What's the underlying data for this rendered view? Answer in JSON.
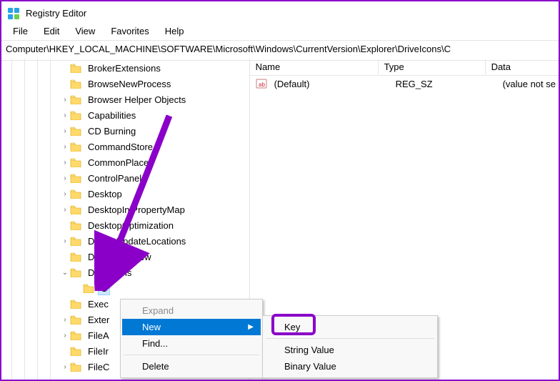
{
  "title": "Registry Editor",
  "menubar": [
    "File",
    "Edit",
    "View",
    "Favorites",
    "Help"
  ],
  "path": "Computer\\HKEY_LOCAL_MACHINE\\SOFTWARE\\Microsoft\\Windows\\CurrentVersion\\Explorer\\DriveIcons\\C",
  "tree": {
    "items": [
      {
        "label": "BrokerExtensions",
        "level": 5,
        "children": false
      },
      {
        "label": "BrowseNewProcess",
        "level": 5,
        "children": false
      },
      {
        "label": "Browser Helper Objects",
        "level": 5,
        "children": true
      },
      {
        "label": "Capabilities",
        "level": 5,
        "children": true
      },
      {
        "label": "CD Burning",
        "level": 5,
        "children": true
      },
      {
        "label": "CommandStore",
        "level": 5,
        "children": true
      },
      {
        "label": "CommonPlaces",
        "level": 5,
        "children": true
      },
      {
        "label": "ControlPanel",
        "level": 5,
        "children": true
      },
      {
        "label": "Desktop",
        "level": 5,
        "children": true
      },
      {
        "label": "DesktopIniPropertyMap",
        "level": 5,
        "children": true
      },
      {
        "label": "DesktopOptimization",
        "level": 5,
        "children": false
      },
      {
        "label": "DeviceUpdateLocations",
        "level": 5,
        "children": true
      },
      {
        "label": "DocObjectView",
        "level": 5,
        "children": false
      },
      {
        "label": "DriveIcons",
        "level": 5,
        "children": true,
        "expanded": true
      },
      {
        "label": "C",
        "level": 6,
        "children": false,
        "selected": true
      },
      {
        "label": "Exec",
        "level": 5,
        "children": false
      },
      {
        "label": "Exter",
        "level": 5,
        "children": true
      },
      {
        "label": "FileA",
        "level": 5,
        "children": true
      },
      {
        "label": "FileIr",
        "level": 5,
        "children": false
      },
      {
        "label": "FileC",
        "level": 5,
        "children": true
      }
    ]
  },
  "list": {
    "cols": {
      "name": "Name",
      "type": "Type",
      "data": "Data"
    },
    "rows": [
      {
        "name": "(Default)",
        "type": "REG_SZ",
        "data": "(value not se"
      }
    ]
  },
  "ctx": {
    "expand": "Expand",
    "new": "New",
    "find": "Find...",
    "delete": "Delete"
  },
  "submenu": {
    "key": "Key",
    "string": "String Value",
    "binary": "Binary Value"
  }
}
